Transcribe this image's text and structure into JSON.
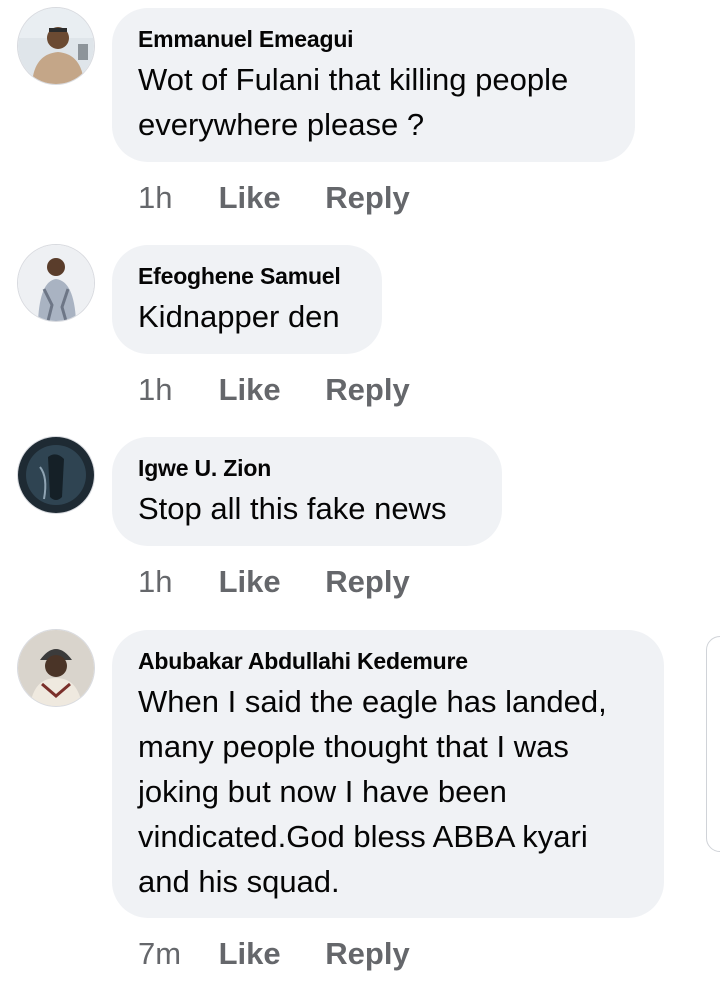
{
  "comments": [
    {
      "author": "Emmanuel Emeagui",
      "text_lines": [
        "Wot of Fulani that killing people",
        "everywhere please ?"
      ],
      "time": "1h",
      "like": "Like",
      "reply": "Reply"
    },
    {
      "author": "Efeoghene Samuel",
      "text_lines": [
        "Kidnapper den"
      ],
      "time": "1h",
      "like": "Like",
      "reply": "Reply"
    },
    {
      "author": "Igwe U. Zion",
      "text_lines": [
        "Stop all this fake news"
      ],
      "time": "1h",
      "like": "Like",
      "reply": "Reply"
    },
    {
      "author": "Abubakar Abdullahi Kedemure",
      "text_lines": [
        "When I said the eagle has landed,",
        "many people thought that I was",
        "joking but now I have been",
        "vindicated.God bless ABBA kyari",
        "and his squad."
      ],
      "time": "7m",
      "like": "Like",
      "reply": "Reply"
    }
  ],
  "colors": {
    "bubble": "#f0f2f5",
    "meta_text": "#65676b",
    "body_text": "#050505"
  }
}
